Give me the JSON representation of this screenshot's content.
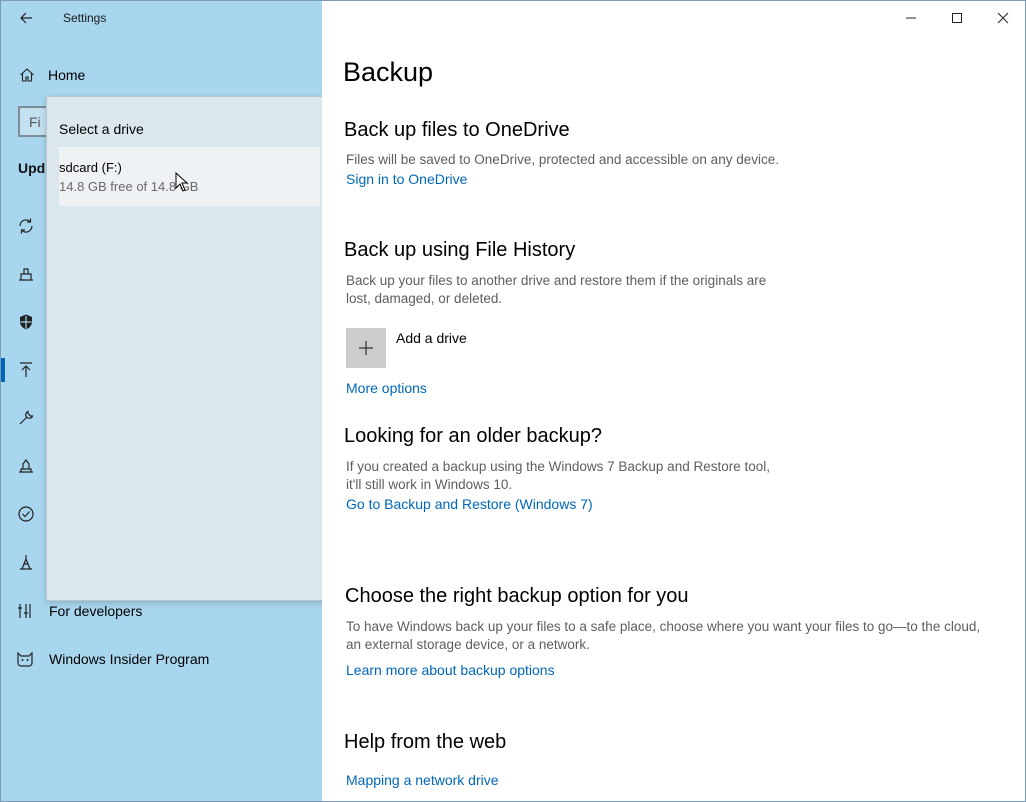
{
  "window": {
    "title": "Settings"
  },
  "sidebar": {
    "home_label": "Home",
    "search_placeholder": "Fi",
    "section_label": "Upd",
    "icons": [
      "sync-icon",
      "delivery-icon",
      "shield-icon",
      "backup-icon",
      "wrench-icon",
      "recovery-icon",
      "activation-icon",
      "find-device-icon"
    ],
    "items": [
      {
        "label": "For developers",
        "icon": "developer-tools-icon"
      },
      {
        "label": "Windows Insider Program",
        "icon": "insider-cat-icon"
      }
    ],
    "accent_color": "#0067b8"
  },
  "flyout": {
    "title": "Select a drive",
    "drive": {
      "name": "sdcard (F:)",
      "free": "14.8 GB free of 14.8 GB"
    }
  },
  "main": {
    "page_title": "Backup",
    "onedrive": {
      "heading": "Back up files to OneDrive",
      "description": "Files will be saved to OneDrive, protected and accessible on any device.",
      "link": "Sign in to OneDrive"
    },
    "file_history": {
      "heading": "Back up using File History",
      "description_line1": "Back up your files to another drive and restore them if the originals are",
      "description_line2": "lost, damaged, or deleted.",
      "add_drive": "Add a drive",
      "more_options": "More options"
    },
    "older_backup": {
      "heading": "Looking for an older backup?",
      "description_line1": "If you created a backup using the Windows 7 Backup and Restore tool,",
      "description_line2": "it'll still work in Windows 10.",
      "link": "Go to Backup and Restore (Windows 7)"
    },
    "right_option": {
      "heading": "Choose the right backup option for you",
      "description_line1": "To have Windows back up your files to a safe place, choose where you want your files to go—to the cloud,",
      "description_line2": "an external storage device, or a network.",
      "link": "Learn more about backup options"
    },
    "help": {
      "heading": "Help from the web",
      "link": "Mapping a network drive"
    }
  },
  "titlebar": {
    "buttons": [
      "minimize-icon",
      "maximize-icon",
      "close-icon"
    ]
  }
}
